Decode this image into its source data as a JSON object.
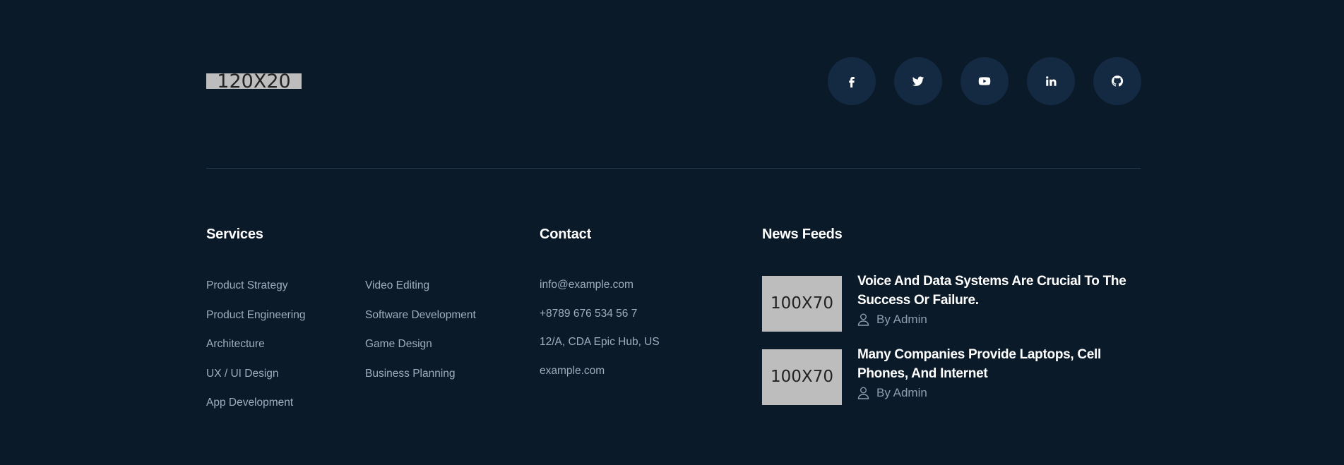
{
  "logo": {
    "text": "120X20"
  },
  "social": [
    {
      "name": "facebook-icon"
    },
    {
      "name": "twitter-icon"
    },
    {
      "name": "youtube-icon"
    },
    {
      "name": "linkedin-icon"
    },
    {
      "name": "github-icon"
    }
  ],
  "services": {
    "heading": "Services",
    "col1": [
      "Product Strategy",
      "Product Engineering",
      "Architecture",
      "UX / UI Design",
      "App Development"
    ],
    "col2": [
      "Video Editing",
      "Software Development",
      "Game Design",
      "Business Planning"
    ]
  },
  "contact": {
    "heading": "Contact",
    "items": [
      "info@example.com",
      "+8789 676 534 56 7",
      "12/A, CDA Epic Hub, US",
      "example.com"
    ]
  },
  "news": {
    "heading": "News Feeds",
    "items": [
      {
        "thumb": "100X70",
        "title": "Voice And Data Systems Are Crucial To The Success Or Failure.",
        "author": "By Admin"
      },
      {
        "thumb": "100X70",
        "title": "Many Companies Provide Laptops, Cell Phones, And Internet",
        "author": "By Admin"
      }
    ]
  },
  "colors": {
    "background": "#0b1a29",
    "social_bg": "#132a42",
    "heading": "#ffffff",
    "text": "#9fadbd"
  }
}
